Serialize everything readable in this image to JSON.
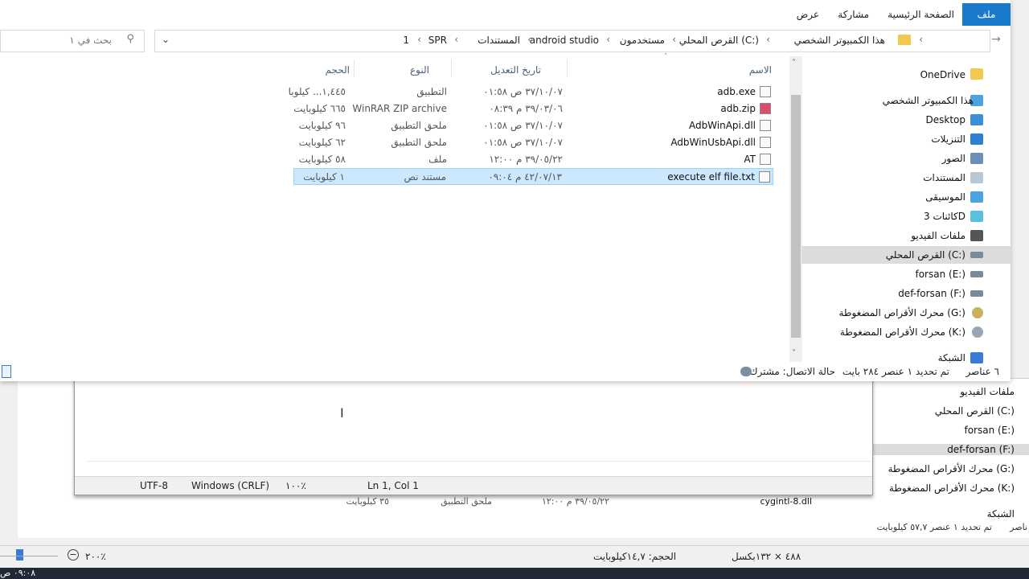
{
  "ribbon": {
    "tabs": [
      "ملف",
      "الصفحة الرئيسية",
      "مشاركة",
      "عرض"
    ]
  },
  "address": {
    "crumbs": [
      "هذا الكمبيوتر الشخصي",
      "القرص المحلي (C:)",
      "مستخدمون",
      "android studio",
      "المستندات",
      "SPR",
      "1"
    ],
    "search_placeholder": "بحث في ١"
  },
  "columns": {
    "name": "الاسم",
    "date": "تاريخ التعديل",
    "type": "النوع",
    "size": "الحجم"
  },
  "files": [
    {
      "name": "adb.exe",
      "date": "٣٧/١٠/٠٧ ص ٠١:٥٨",
      "type": "التطبيق",
      "size": "١,٤٤٥... كيلوبا",
      "icon": "exe-icon"
    },
    {
      "name": "adb.zip",
      "date": "٣٩/٠٣/٠٦ م ٠٨:٣٩",
      "type": "WinRAR ZIP archive",
      "size": "٦٦٥ كيلوبايت",
      "icon": "zip-icon"
    },
    {
      "name": "AdbWinApi.dll",
      "date": "٣٧/١٠/٠٧ ص ٠١:٥٨",
      "type": "ملحق التطبيق",
      "size": "٩٦ كيلوبايت",
      "icon": "dll-icon"
    },
    {
      "name": "AdbWinUsbApi.dll",
      "date": "٣٧/١٠/٠٧ ص ٠١:٥٨",
      "type": "ملحق التطبيق",
      "size": "٦٢ كيلوبايت",
      "icon": "dll-icon"
    },
    {
      "name": "AT",
      "date": "٣٩/٠٥/٢٢ م ١٢:٠٠",
      "type": "ملف",
      "size": "٥٨ كيلوبايت",
      "icon": "file-icon"
    },
    {
      "name": "execute elf file.txt",
      "date": "٤٢/٠٧/١٣ م ٠٩:٠٤",
      "type": "مستند نص",
      "size": "١ كيلوبايت",
      "icon": "text-file-icon",
      "selected": true
    }
  ],
  "nav_pane": [
    {
      "label": "OneDrive",
      "icon": "folder-icon",
      "color": "#f2c94c"
    },
    {
      "label": "هذا الكمبيوتر الشخصي",
      "icon": "computer-icon",
      "color": "#4aa3df"
    },
    {
      "label": "Desktop",
      "icon": "desktop-icon",
      "color": "#3c8fd6"
    },
    {
      "label": "التنزيلات",
      "icon": "download-icon",
      "color": "#2f7fd1"
    },
    {
      "label": "الصور",
      "icon": "pictures-icon",
      "color": "#6c8fb5"
    },
    {
      "label": "المستندات",
      "icon": "documents-icon",
      "color": "#b9c6d3"
    },
    {
      "label": "الموسيقى",
      "icon": "music-icon",
      "color": "#4aa3df"
    },
    {
      "label": "كائنات 3D",
      "icon": "3d-objects-icon",
      "color": "#5bc0de"
    },
    {
      "label": "ملفات الفيديو",
      "icon": "videos-icon",
      "color": "#555555"
    },
    {
      "label": "القرص المحلي (C:)",
      "icon": "drive-icon",
      "color": "#7a8a99",
      "selected": true
    },
    {
      "label": "forsan (E:)",
      "icon": "drive-icon",
      "color": "#7a8a99"
    },
    {
      "label": "def-forsan (F:)",
      "icon": "drive-icon",
      "color": "#7a8a99"
    },
    {
      "label": "محرك الأقراص المضغوطة (G:)",
      "icon": "cd-drive-icon",
      "color": "#c9b25a"
    },
    {
      "label": "محرك الأقراص المضغوطة (K:)",
      "icon": "cd-drive-icon",
      "color": "#9aa6b2"
    },
    {
      "label": "الشبكة",
      "icon": "network-icon",
      "color": "#3a7bd5"
    }
  ],
  "status": {
    "count": "٦ عناصر",
    "selected": "تم تحديد ١ عنصر ٢٨٤ بايت",
    "connection": "حالة الاتصال: مشترك"
  },
  "notepad": {
    "position": "Ln 1, Col 1",
    "zoom": "١٠٠٪",
    "line_ending": "Windows (CRLF)",
    "encoding": "UTF-8"
  },
  "bg_explorer": {
    "nav": [
      "ملفات الفيديو",
      "القرص المحلي (C:)",
      "forsan (E:)",
      "def-forsan (F:)",
      "محرك الأقراص المضغوطة (G:)",
      "محرك الأقراص المضغوطة (K:)",
      "الشبكة"
    ],
    "row_name": "cygintl-8.dll",
    "row_date": "٣٩/٠٥/٢٢ م ١٢:٠٠",
    "row_type": "ملحق التطبيق",
    "row_size": "٣٥ كيلوبايت",
    "status": "تم تحديد ١ عنصر ٥٧,٧ كيلوبايت",
    "status_left": "ناصر"
  },
  "viewer": {
    "zoom": "٢٠٠٪",
    "size": "الحجم: ١٤,٧كيلوبايت",
    "dims": "٤٨٨ × ١٣٢بكسل"
  },
  "clock": "٠٩:٠٨ ص"
}
